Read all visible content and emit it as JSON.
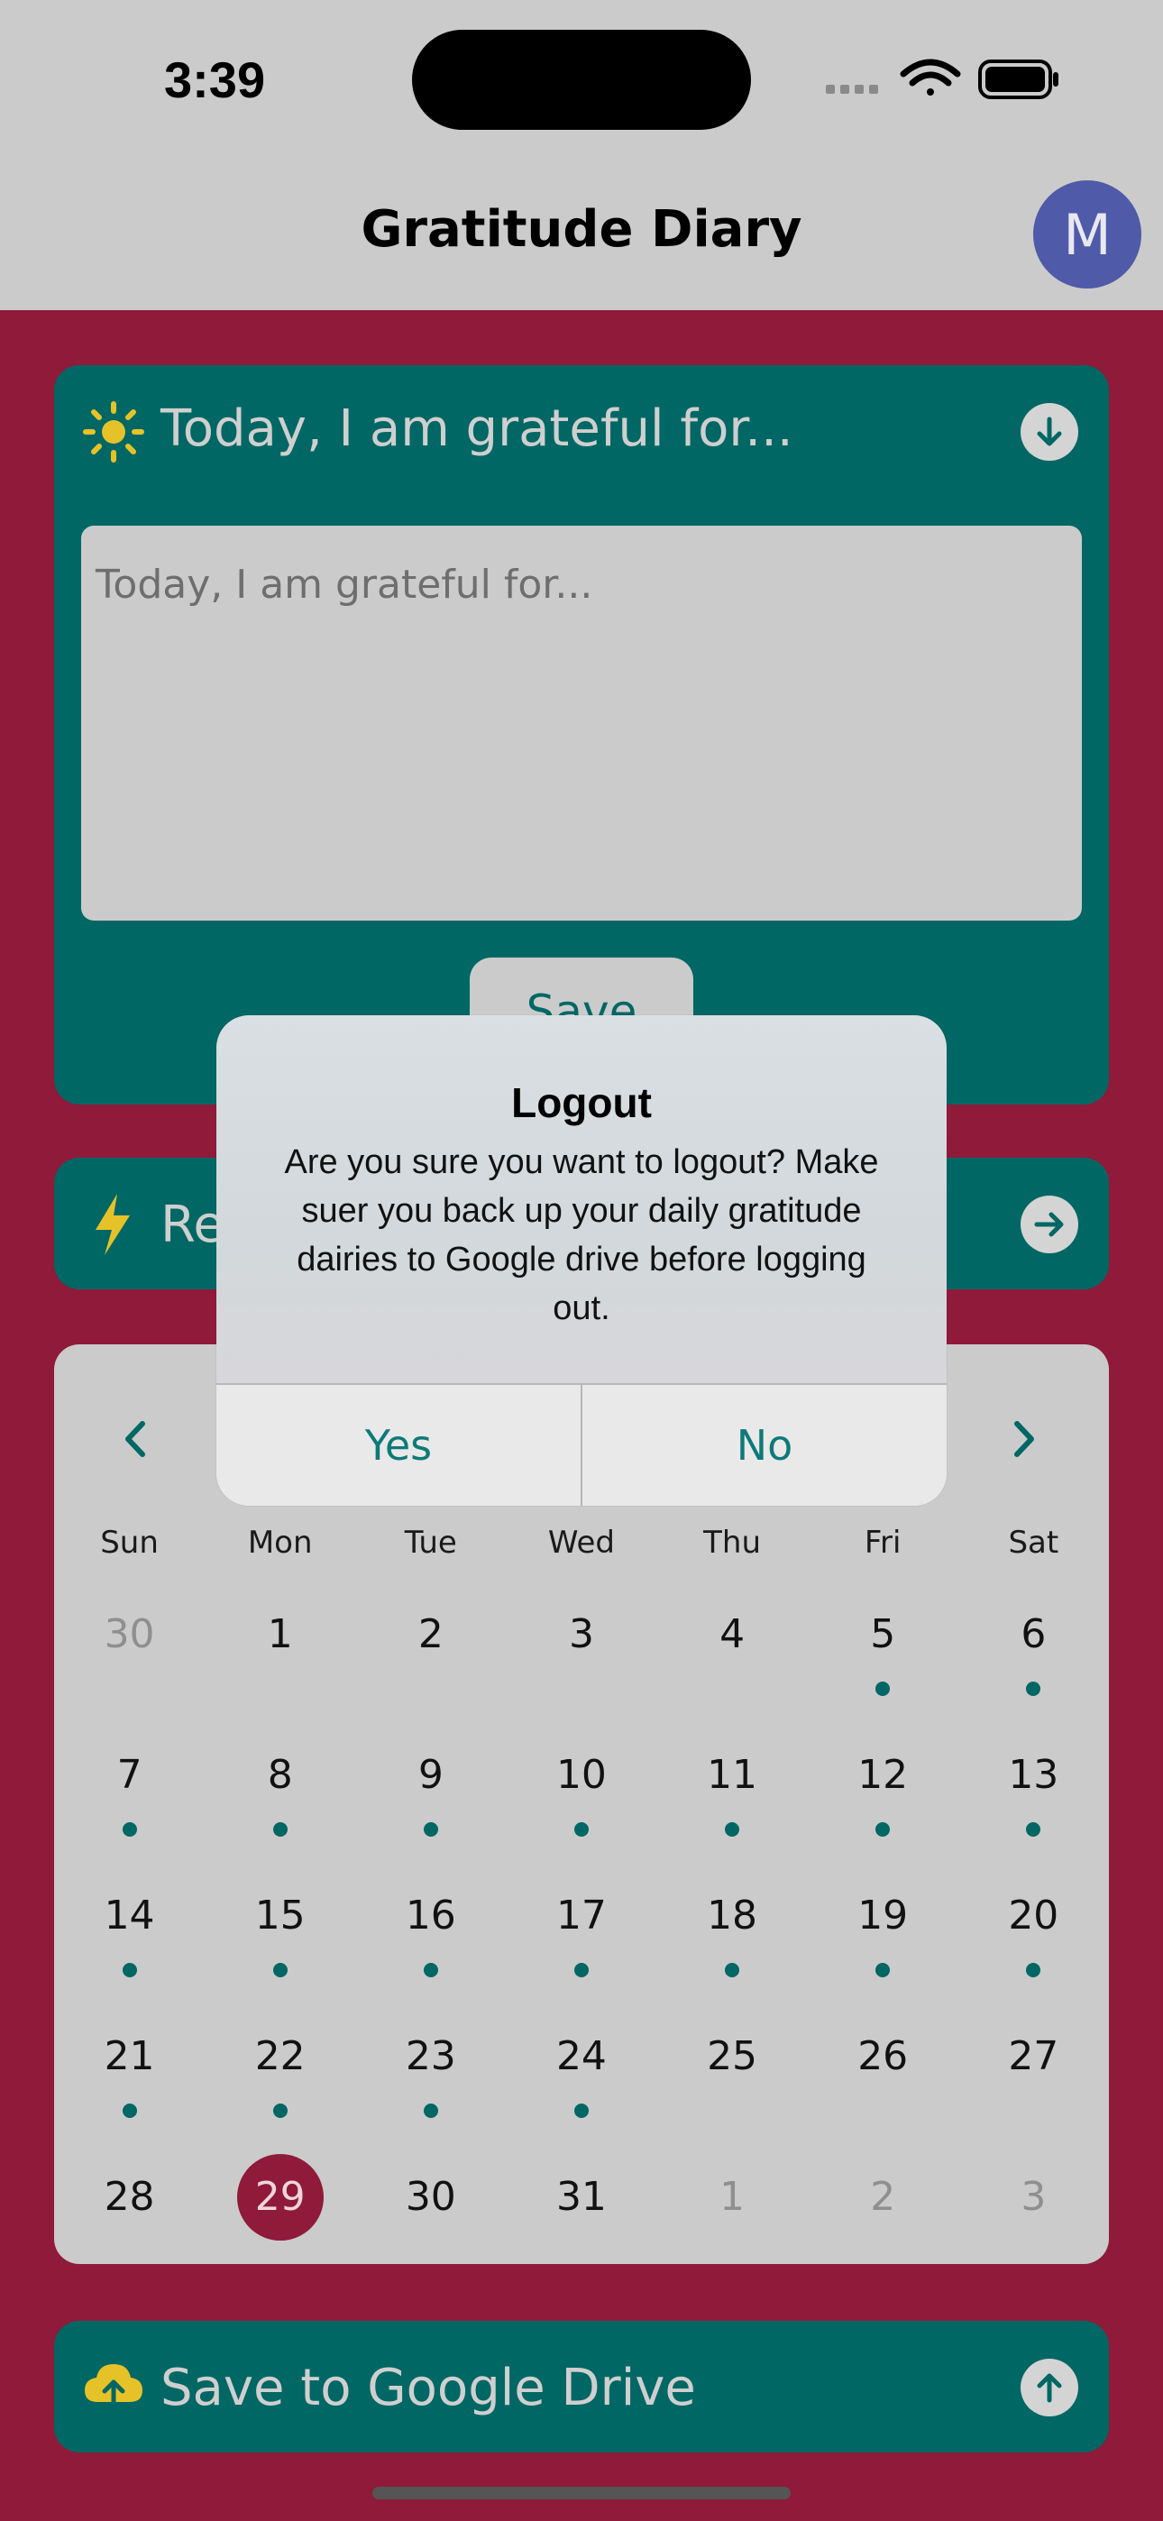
{
  "status_bar": {
    "time": "3:39"
  },
  "header": {
    "title": "Gratitude Diary",
    "avatar_initial": "M"
  },
  "gratitude_card": {
    "title": "Today, I am grateful for...",
    "input_placeholder": "Today, I am grateful for...",
    "save_label": "Save"
  },
  "reminder_card": {
    "title_visible": "Re"
  },
  "calendar": {
    "prev_icon": "chevron-left-icon",
    "next_icon": "chevron-right-icon",
    "weekdays": [
      "Sun",
      "Mon",
      "Tue",
      "Wed",
      "Thu",
      "Fri",
      "Sat"
    ],
    "weeks": [
      [
        {
          "d": "30",
          "muted": true
        },
        {
          "d": "1"
        },
        {
          "d": "2"
        },
        {
          "d": "3"
        },
        {
          "d": "4"
        },
        {
          "d": "5",
          "dot": true
        },
        {
          "d": "6",
          "dot": true
        }
      ],
      [
        {
          "d": "7",
          "dot": true
        },
        {
          "d": "8",
          "dot": true
        },
        {
          "d": "9",
          "dot": true
        },
        {
          "d": "10",
          "dot": true
        },
        {
          "d": "11",
          "dot": true
        },
        {
          "d": "12",
          "dot": true
        },
        {
          "d": "13",
          "dot": true
        }
      ],
      [
        {
          "d": "14",
          "dot": true
        },
        {
          "d": "15",
          "dot": true
        },
        {
          "d": "16",
          "dot": true
        },
        {
          "d": "17",
          "dot": true
        },
        {
          "d": "18",
          "dot": true
        },
        {
          "d": "19",
          "dot": true
        },
        {
          "d": "20",
          "dot": true
        }
      ],
      [
        {
          "d": "21",
          "dot": true
        },
        {
          "d": "22",
          "dot": true
        },
        {
          "d": "23",
          "dot": true
        },
        {
          "d": "24",
          "dot": true
        },
        {
          "d": "25"
        },
        {
          "d": "26"
        },
        {
          "d": "27"
        }
      ],
      [
        {
          "d": "28"
        },
        {
          "d": "29",
          "selected": true
        },
        {
          "d": "30"
        },
        {
          "d": "31"
        },
        {
          "d": "1",
          "muted": true
        },
        {
          "d": "2",
          "muted": true
        },
        {
          "d": "3",
          "muted": true
        }
      ]
    ]
  },
  "drive_card": {
    "title": "Save to Google Drive"
  },
  "alert": {
    "title": "Logout",
    "message": "Are you sure you want to logout? Make suer you back up your daily gratitude dairies to Google drive before logging out.",
    "yes_label": "Yes",
    "no_label": "No"
  },
  "colors": {
    "background": "#8f1a3a",
    "teal": "#006764",
    "light_gray": "#cbcbcb",
    "avatar": "#4f5aa8",
    "sun": "#e6c229"
  }
}
